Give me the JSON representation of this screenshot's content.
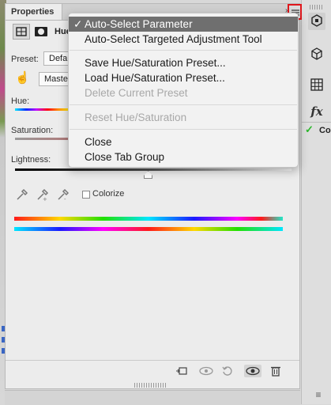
{
  "panel": {
    "tab_title": "Properties",
    "collapse_glyph": "»",
    "adjustment_title": "Hue",
    "preset_label": "Preset:",
    "preset_value": "Defau",
    "channel_value": "Master",
    "hue_label": "Hue:",
    "saturation_label": "Saturation:",
    "lightness_label": "Lightness:",
    "colorize_label": "Colorize",
    "colorize_checked": false
  },
  "menu": {
    "items": [
      {
        "label": "Auto-Select Parameter",
        "checked": true,
        "enabled": true,
        "highlighted": true
      },
      {
        "label": "Auto-Select Targeted Adjustment Tool",
        "enabled": true
      },
      {
        "label": "Save Hue/Saturation Preset...",
        "enabled": true
      },
      {
        "label": "Load Hue/Saturation Preset...",
        "enabled": true
      },
      {
        "label": "Delete Current Preset",
        "enabled": false
      },
      {
        "label": "Reset Hue/Saturation",
        "enabled": false
      },
      {
        "label": "Close",
        "enabled": true
      },
      {
        "label": "Close Tab Group",
        "enabled": true
      }
    ],
    "check_glyph": "✓"
  },
  "dock": {
    "partial_label": "Co"
  },
  "icons": {
    "menu_button": "hamburger-menu-icon",
    "eyedroppers": [
      "eyedropper-icon",
      "eyedropper-plus-icon",
      "eyedropper-minus-icon"
    ],
    "bottom_toolbar": [
      "clip-to-layer-icon",
      "view-previous-icon",
      "reset-icon",
      "visibility-icon",
      "trash-icon"
    ]
  },
  "colors": {
    "highlight_bg": "#6f6f6f",
    "annotation_red": "#e0161b",
    "dock_checkmark": "#2db82d"
  }
}
